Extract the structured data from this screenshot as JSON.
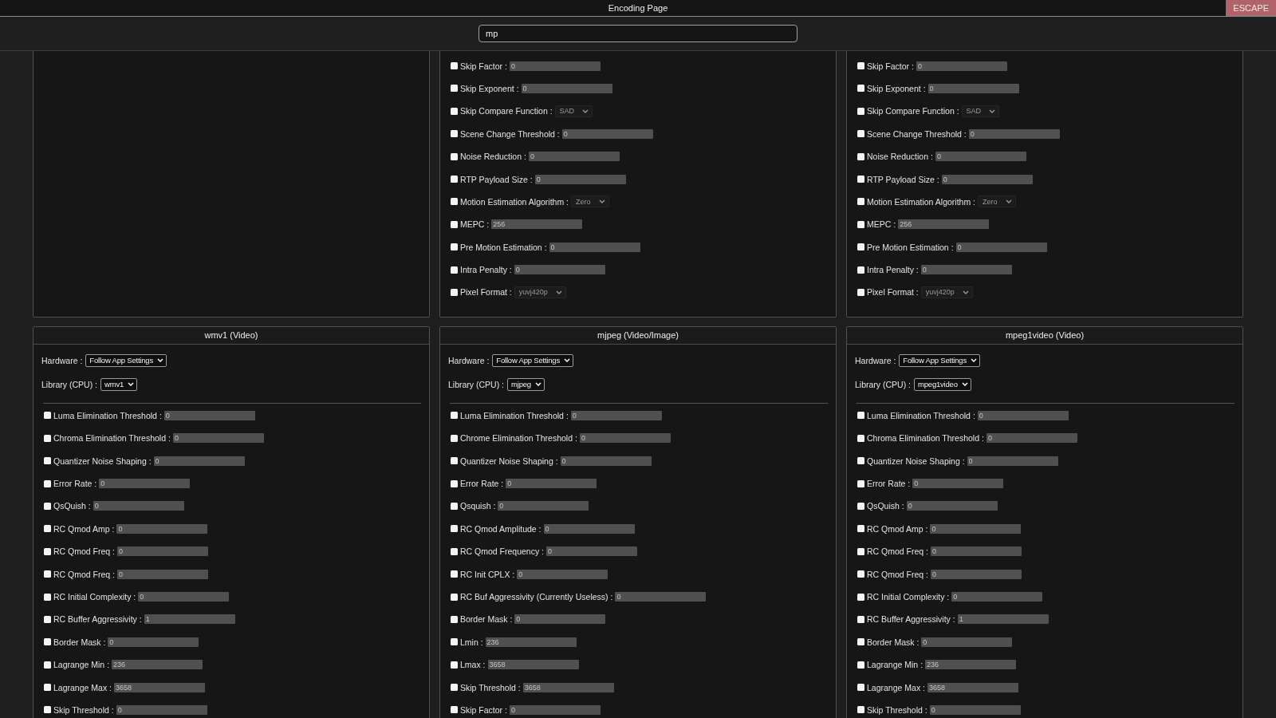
{
  "top_bar": {
    "title": "Encoding Page",
    "escape_button": "ESCAPE"
  },
  "search": {
    "value": "mp"
  },
  "panels": [
    {
      "options": [
        {
          "label": "Skip Factor :",
          "kind": "number",
          "value": "0",
          "checked": false
        },
        {
          "label": "Skip Exponent :",
          "kind": "number",
          "value": "0",
          "checked": false
        },
        {
          "label": "Skip Compare Function :",
          "kind": "select",
          "value": "SAD",
          "checked": false
        },
        {
          "label": "Scene Change Threshold :",
          "kind": "number",
          "value": "0",
          "checked": false
        },
        {
          "label": "Noise Reduction :",
          "kind": "number",
          "value": "0",
          "checked": false
        },
        {
          "label": "RTP Payload Size :",
          "kind": "number",
          "value": "0",
          "checked": false
        },
        {
          "label": "Motion Estimation Algorithm :",
          "kind": "select",
          "value": "Zero",
          "checked": false
        },
        {
          "label": "MEPC :",
          "kind": "number",
          "value": "256",
          "checked": false
        },
        {
          "label": "Pre Motion Estimation :",
          "kind": "number",
          "value": "0",
          "checked": false
        },
        {
          "label": "Intra Penalty :",
          "kind": "number",
          "value": "0",
          "checked": false
        },
        {
          "label": "Pixel Format :",
          "kind": "select",
          "value": "yuvj420p",
          "checked": false
        }
      ]
    },
    {
      "options": [
        {
          "label": "Skip Factor :",
          "kind": "number",
          "value": "0",
          "checked": false
        },
        {
          "label": "Skip Exponent :",
          "kind": "number",
          "value": "0",
          "checked": false
        },
        {
          "label": "Skip Compare Function :",
          "kind": "select",
          "value": "SAD",
          "checked": false
        },
        {
          "label": "Scene Change Threshold :",
          "kind": "number",
          "value": "0",
          "checked": false
        },
        {
          "label": "Noise Reduction :",
          "kind": "number",
          "value": "0",
          "checked": false
        },
        {
          "label": "RTP Payload Size :",
          "kind": "number",
          "value": "0",
          "checked": false
        },
        {
          "label": "Motion Estimation Algorithm :",
          "kind": "select",
          "value": "Zero",
          "checked": false
        },
        {
          "label": "MEPC :",
          "kind": "number",
          "value": "256",
          "checked": false
        },
        {
          "label": "Pre Motion Estimation :",
          "kind": "number",
          "value": "0",
          "checked": false
        },
        {
          "label": "Intra Penalty :",
          "kind": "number",
          "value": "0",
          "checked": false
        },
        {
          "label": "Pixel Format :",
          "kind": "select",
          "value": "yuvj420p",
          "checked": false
        }
      ]
    },
    {
      "title": "wmv1 (Video)",
      "hardware": {
        "label": "Hardware :",
        "value": "Follow App Settings"
      },
      "library": {
        "label": "Library (CPU) :",
        "value": "wmv1"
      },
      "options": [
        {
          "label": "Luma Elimination Threshold :",
          "kind": "number",
          "value": "0",
          "checked": false
        },
        {
          "label": "Chroma Elimination Threshold :",
          "kind": "number",
          "value": "0",
          "checked": false
        },
        {
          "label": "Quantizer Noise Shaping :",
          "kind": "number",
          "value": "0",
          "checked": false
        },
        {
          "label": "Error Rate :",
          "kind": "number",
          "value": "0",
          "checked": false
        },
        {
          "label": "QsQuish :",
          "kind": "number",
          "value": "0",
          "checked": false
        },
        {
          "label": "RC Qmod Amp :",
          "kind": "number",
          "value": "0",
          "checked": false
        },
        {
          "label": "RC Qmod Freq :",
          "kind": "number",
          "value": "0",
          "checked": false
        },
        {
          "label": "RC Qmod Freq :",
          "kind": "number",
          "value": "0",
          "checked": false
        },
        {
          "label": "RC Initial Complexity :",
          "kind": "number",
          "value": "0",
          "checked": false
        },
        {
          "label": "RC Buffer Aggressivity :",
          "kind": "number",
          "value": "1",
          "checked": false
        },
        {
          "label": "Border Mask :",
          "kind": "number",
          "value": "0",
          "checked": false
        },
        {
          "label": "Lagrange Min :",
          "kind": "number",
          "value": "236",
          "checked": false
        },
        {
          "label": "Lagrange Max :",
          "kind": "number",
          "value": "3658",
          "checked": false
        },
        {
          "label": "Skip Threshold :",
          "kind": "number",
          "value": "0",
          "checked": false
        }
      ]
    },
    {
      "title": "mjpeg (Video/Image)",
      "hardware": {
        "label": "Hardware :",
        "value": "Follow App Settings"
      },
      "library": {
        "label": "Library (CPU) :",
        "value": "mjpeg"
      },
      "options": [
        {
          "label": "Luma Elimination Threshold :",
          "kind": "number",
          "value": "0",
          "checked": false
        },
        {
          "label": "Chrome Elimination Threshold :",
          "kind": "number",
          "value": "0",
          "checked": false
        },
        {
          "label": "Quantizer Noise Shaping :",
          "kind": "number",
          "value": "0",
          "checked": false
        },
        {
          "label": "Error Rate :",
          "kind": "number",
          "value": "0",
          "checked": false
        },
        {
          "label": "Qsquish :",
          "kind": "number",
          "value": "0",
          "checked": false
        },
        {
          "label": "RC Qmod Amplitude :",
          "kind": "number",
          "value": "0",
          "checked": false
        },
        {
          "label": "RC Qmod Frequency :",
          "kind": "number",
          "value": "0",
          "checked": false
        },
        {
          "label": "RC Init CPLX :",
          "kind": "number",
          "value": "0",
          "checked": false
        },
        {
          "label": "RC Buf Aggressivity (Currently Useless) :",
          "kind": "number",
          "value": "0",
          "checked": false
        },
        {
          "label": "Border Mask :",
          "kind": "number",
          "value": "0",
          "checked": false
        },
        {
          "label": "Lmin :",
          "kind": "number",
          "value": "236",
          "checked": false
        },
        {
          "label": "Lmax :",
          "kind": "number",
          "value": "3658",
          "checked": false
        },
        {
          "label": "Skip Threshold :",
          "kind": "number",
          "value": "3658",
          "checked": false
        },
        {
          "label": "Skip Factor :",
          "kind": "number",
          "value": "0",
          "checked": false
        }
      ]
    },
    {
      "title": "mpeg1video (Video)",
      "hardware": {
        "label": "Hardware :",
        "value": "Follow App Settings"
      },
      "library": {
        "label": "Library (CPU) :",
        "value": "mpeg1video"
      },
      "options": [
        {
          "label": "Luma Elimination Threshold :",
          "kind": "number",
          "value": "0",
          "checked": false
        },
        {
          "label": "Chroma Elimination Threshold :",
          "kind": "number",
          "value": "0",
          "checked": false
        },
        {
          "label": "Quantizer Noise Shaping :",
          "kind": "number",
          "value": "0",
          "checked": false
        },
        {
          "label": "Error Rate :",
          "kind": "number",
          "value": "0",
          "checked": false
        },
        {
          "label": "QsQuish :",
          "kind": "number",
          "value": "0",
          "checked": false
        },
        {
          "label": "RC Qmod Amp :",
          "kind": "number",
          "value": "0",
          "checked": false
        },
        {
          "label": "RC Qmod Freq :",
          "kind": "number",
          "value": "0",
          "checked": false
        },
        {
          "label": "RC Qmod Freq :",
          "kind": "number",
          "value": "0",
          "checked": false
        },
        {
          "label": "RC Initial Complexity :",
          "kind": "number",
          "value": "0",
          "checked": false
        },
        {
          "label": "RC Buffer Aggressivity :",
          "kind": "number",
          "value": "1",
          "checked": false
        },
        {
          "label": "Border Mask :",
          "kind": "number",
          "value": "0",
          "checked": false
        },
        {
          "label": "Lagrange Min :",
          "kind": "number",
          "value": "236",
          "checked": false
        },
        {
          "label": "Lagrange Max :",
          "kind": "number",
          "value": "3658",
          "checked": false
        },
        {
          "label": "Skip Threshold :",
          "kind": "number",
          "value": "0",
          "checked": false
        }
      ]
    }
  ]
}
